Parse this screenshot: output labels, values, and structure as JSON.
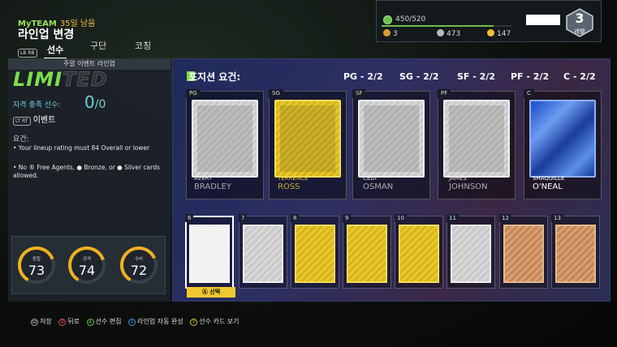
{
  "header": {
    "brand": "MyTEAM",
    "days_left": "35일 남음",
    "title": "라인업 변경",
    "lb_rb": "LB RB",
    "tabs": [
      {
        "label": "선수",
        "active": true
      },
      {
        "label": "구단",
        "active": false
      },
      {
        "label": "코칭",
        "active": false
      }
    ]
  },
  "resources": {
    "xp": "450/520",
    "xp_progress": 0.8654,
    "tokens": "3",
    "mt": "473",
    "coins": "147",
    "level": "3",
    "level_label": "레벨"
  },
  "left": {
    "header": "주말 이벤트 라인업",
    "logo_lit": "LIMI",
    "logo_dim": "TED",
    "eligible_label": "자격 충족 선수:",
    "eligible_count": "0",
    "eligible_total": "/0",
    "event_keys": "LT RT",
    "event_label": "이벤트",
    "requirements_title": "요건:",
    "requirements": [
      "• Your lineup rating must 84 Overall or lower",
      "• No ® Free Agents, ● Bronze, or ● Silver cards allowed."
    ],
    "stats": [
      {
        "label": "종합",
        "value": "73",
        "fraction": 0.73
      },
      {
        "label": "공격",
        "value": "74",
        "fraction": 0.74
      },
      {
        "label": "수비",
        "value": "72",
        "fraction": 0.72
      }
    ]
  },
  "right": {
    "header": "포지션 요건:",
    "position_requirements": [
      "PG - 2/2",
      "SG - 2/2",
      "SF - 2/2",
      "PF - 2/2",
      "C - 2/2"
    ],
    "starters": [
      {
        "pos": "PG",
        "first": "AVERY",
        "last": "BRADLEY",
        "tier": "silver"
      },
      {
        "pos": "SG",
        "first": "TERRENCE",
        "last": "ROSS",
        "tier": "gold"
      },
      {
        "pos": "SF",
        "first": "CEDI",
        "last": "OSMAN",
        "tier": "silver"
      },
      {
        "pos": "PF",
        "first": "JAMES",
        "last": "JOHNSON",
        "tier": "silver"
      },
      {
        "pos": "C",
        "first": "SHAQUILLE",
        "last": "O'NEAL",
        "tier": "sapphire"
      }
    ],
    "bench": [
      {
        "num": "6",
        "tier": "empty"
      },
      {
        "num": "7",
        "tier": "silver"
      },
      {
        "num": "8",
        "tier": "gold"
      },
      {
        "num": "9",
        "tier": "gold"
      },
      {
        "num": "10",
        "tier": "gold"
      },
      {
        "num": "11",
        "tier": "silver"
      },
      {
        "num": "12",
        "tier": "bronze"
      },
      {
        "num": "13",
        "tier": "bronze"
      }
    ],
    "select_label": "선택"
  },
  "footer": {
    "hints": [
      {
        "key": "⊟",
        "label": "저장"
      },
      {
        "key": "B",
        "label": "뒤로"
      },
      {
        "key": "A",
        "label": "선수 편집"
      },
      {
        "key": "X",
        "label": "라인업 자동 완성"
      },
      {
        "key": "Y",
        "label": "선수 카드 보기"
      }
    ]
  },
  "colors": {
    "accent_green": "#7be04b",
    "gold": "#f0c830",
    "gauge_yellow": "#f0b020"
  }
}
